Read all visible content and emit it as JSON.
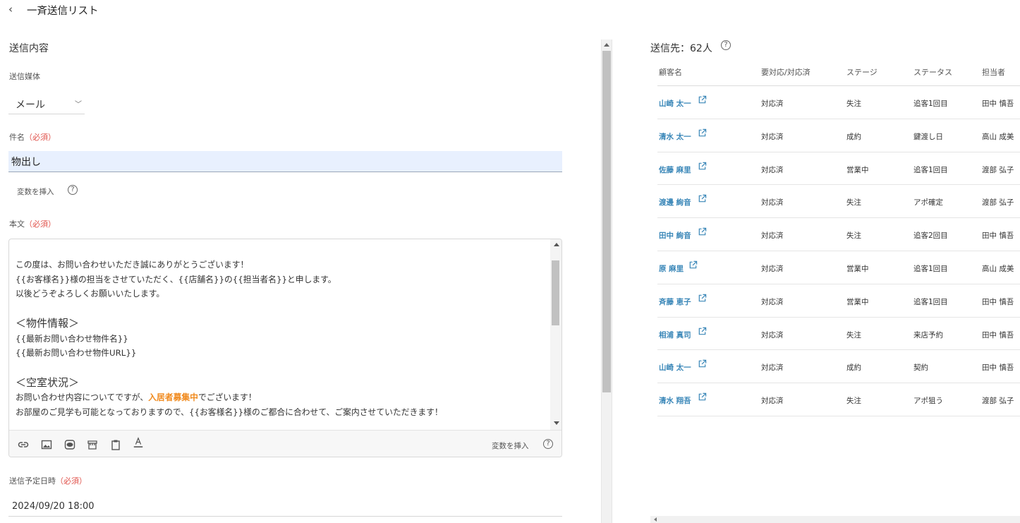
{
  "header": {
    "title": "一斉送信リスト"
  },
  "form": {
    "section_title": "送信内容",
    "media_label": "送信媒体",
    "media_value": "メール",
    "subject_label": "件名",
    "required_text": "（必須）",
    "subject_value": "物出し",
    "insert_variable": "変数を挿入",
    "body_label": "本文",
    "body": {
      "l1": "この度は、お問い合わせいただき誠にありがとうございます！",
      "l2": "{{お客様名}}様の担当をさせていただく、{{店舗名}}の{{担当者名}}と申します。",
      "l3": "以後どうぞよろしくお願いいたします。",
      "l4": "＜物件情報＞",
      "l5": "{{最新お問い合わせ物件名}}",
      "l6": "{{最新お問い合わせ物件URL}}",
      "l7": "＜空室状況＞",
      "l8_pre": "お問い合わせ内容についてですが、",
      "l8_accent": "入居者募集中",
      "l8_post": "でございます！",
      "l9": "お部屋のご見学も可能となっておりますので、{{お客様名}}様のご都合に合わせて、ご案内させていただきます！"
    },
    "toolbar_insert_variable": "変数を挿入",
    "schedule_label": "送信予定日時",
    "schedule_value": "2024/09/20 18:00"
  },
  "recipients": {
    "title": "送信先：62人",
    "columns": [
      "顧客名",
      "要対応/対応済",
      "ステージ",
      "ステータス",
      "担当者"
    ],
    "rows": [
      [
        "山崎 太一",
        "対応済",
        "失注",
        "追客1回目",
        "田中 慎吾"
      ],
      [
        "清水 太一",
        "対応済",
        "成約",
        "鍵渡し日",
        "高山 成美"
      ],
      [
        "佐藤 麻里",
        "対応済",
        "営業中",
        "追客1回目",
        "渡部 弘子"
      ],
      [
        "渡邊 絢音",
        "対応済",
        "失注",
        "アポ確定",
        "渡部 弘子"
      ],
      [
        "田中 絢音",
        "対応済",
        "失注",
        "追客2回目",
        "田中 慎吾"
      ],
      [
        "原 麻里",
        "対応済",
        "営業中",
        "追客1回目",
        "高山 成美"
      ],
      [
        "斉藤 恵子",
        "対応済",
        "営業中",
        "追客1回目",
        "田中 慎吾"
      ],
      [
        "相浦 真司",
        "対応済",
        "失注",
        "来店予約",
        "田中 慎吾"
      ],
      [
        "山崎 太一",
        "対応済",
        "成約",
        "契約",
        "田中 慎吾"
      ],
      [
        "清水 翔吾",
        "対応済",
        "失注",
        "アポ狙う",
        "渡部 弘子"
      ]
    ]
  },
  "colors": {
    "accent": "#f08a1e",
    "link": "#3a87b8",
    "required": "#e0524b",
    "subject_bg": "#e8f0fe"
  },
  "icons": [
    "back-chevron-icon",
    "chevron-down-icon",
    "help-icon",
    "link-icon",
    "image-icon",
    "line-icon",
    "store-icon",
    "clipboard-icon",
    "text-color-icon",
    "external-link-icon"
  ]
}
